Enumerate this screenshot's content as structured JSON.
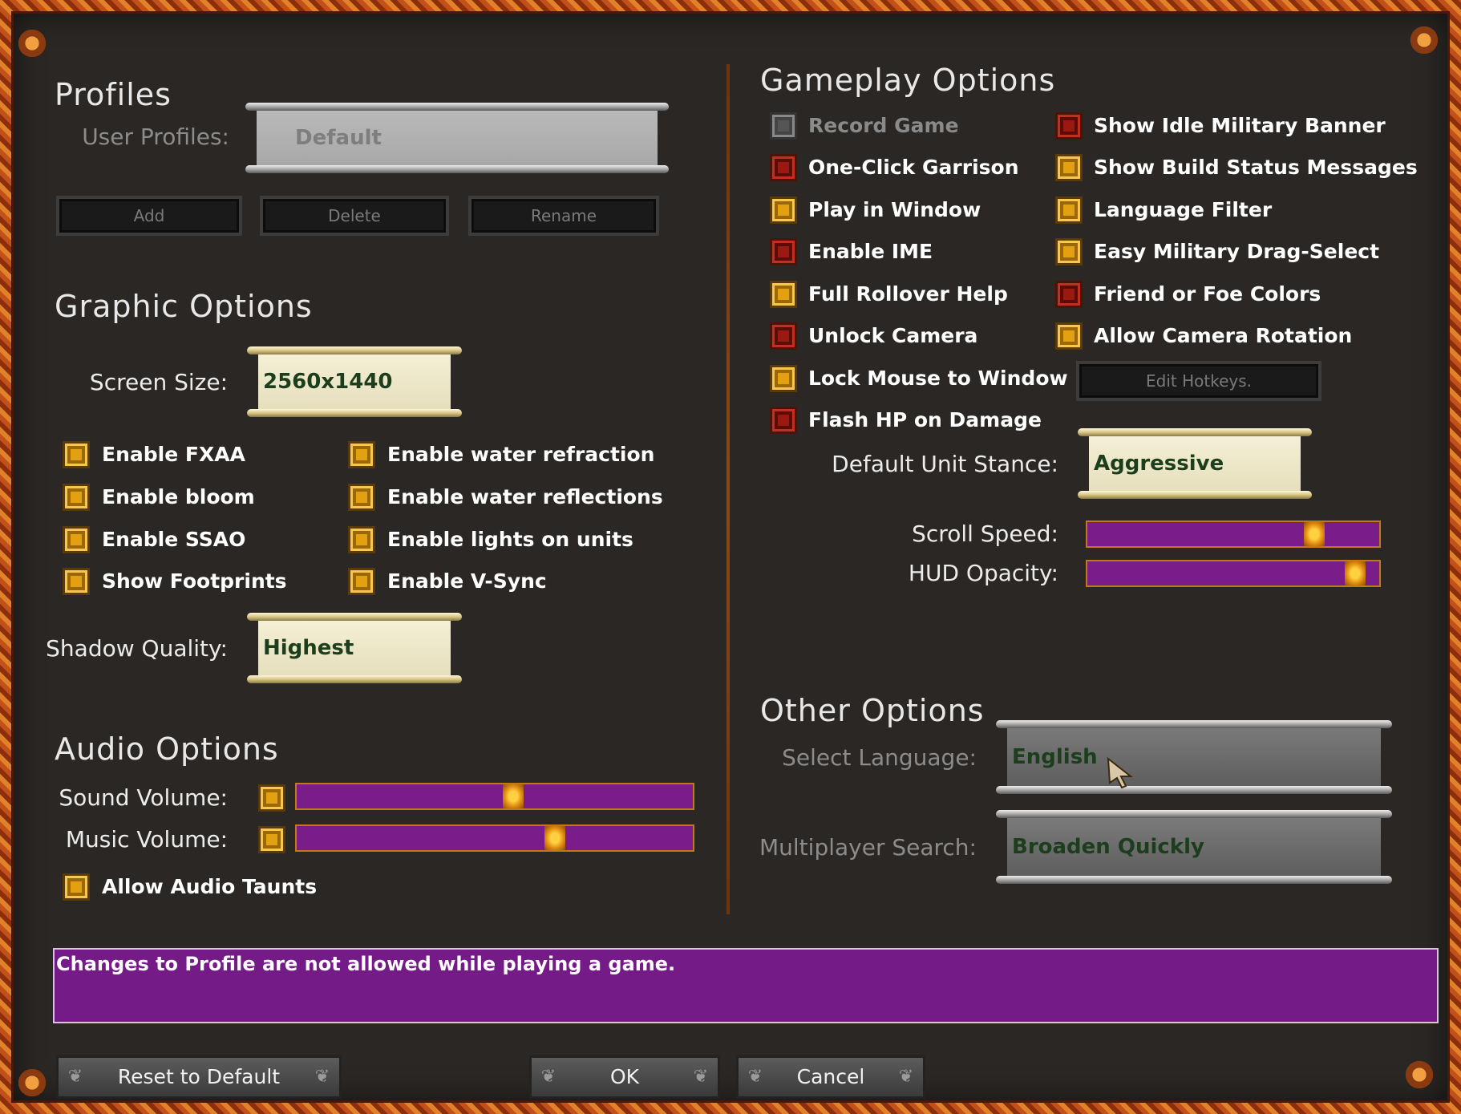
{
  "colors": {
    "frame": "#c2501a",
    "panel": "#2a2724",
    "slider_track": "#7a1c8a",
    "slider_border": "#c07a18",
    "checkbox_on": "#e3a010",
    "checkbox_off": "#9a1a12",
    "message_box": "#741b88",
    "dropdown_text": "#1c3e1c"
  },
  "profiles": {
    "title": "Profiles",
    "user_profiles_label": "User Profiles:",
    "user_profiles_value": "Default",
    "buttons": {
      "add": "Add",
      "delete": "Delete",
      "rename": "Rename"
    }
  },
  "graphic": {
    "title": "Graphic Options",
    "screen_size_label": "Screen Size:",
    "screen_size_value": "2560x1440",
    "checks": [
      {
        "label": "Enable FXAA",
        "checked": true
      },
      {
        "label": "Enable bloom",
        "checked": true
      },
      {
        "label": "Enable SSAO",
        "checked": true
      },
      {
        "label": "Show Footprints",
        "checked": true
      },
      {
        "label": "Enable water refraction",
        "checked": true
      },
      {
        "label": "Enable water reflections",
        "checked": true
      },
      {
        "label": "Enable lights on units",
        "checked": true
      },
      {
        "label": "Enable V-Sync",
        "checked": true
      }
    ],
    "shadow_quality_label": "Shadow Quality:",
    "shadow_quality_value": "Highest"
  },
  "audio": {
    "title": "Audio Options",
    "sound_volume_label": "Sound Volume:",
    "sound_volume_level": 0.55,
    "music_volume_label": "Music Volume:",
    "music_volume_level": 0.66,
    "taunts_label": "Allow Audio Taunts",
    "taunts_checked": true
  },
  "gameplay": {
    "title": "Gameplay Options",
    "left_checks": [
      {
        "label": "Record Game",
        "state": "disabled"
      },
      {
        "label": "One-Click Garrison",
        "state": "off"
      },
      {
        "label": "Play in Window",
        "state": "on"
      },
      {
        "label": "Enable IME",
        "state": "off"
      },
      {
        "label": "Full Rollover Help",
        "state": "on"
      },
      {
        "label": "Unlock Camera",
        "state": "off"
      },
      {
        "label": "Lock Mouse to Window",
        "state": "on"
      },
      {
        "label": "Flash HP on Damage",
        "state": "off"
      }
    ],
    "right_checks": [
      {
        "label": "Show Idle Military Banner",
        "state": "off"
      },
      {
        "label": "Show Build Status Messages",
        "state": "on"
      },
      {
        "label": "Language Filter",
        "state": "on"
      },
      {
        "label": "Easy Military Drag-Select",
        "state": "on"
      },
      {
        "label": "Friend or Foe Colors",
        "state": "off"
      },
      {
        "label": "Allow Camera Rotation",
        "state": "on"
      }
    ],
    "edit_hotkeys_label": "Edit Hotkeys.",
    "default_stance_label": "Default Unit Stance:",
    "default_stance_value": "Aggressive",
    "scroll_speed_label": "Scroll Speed:",
    "scroll_speed_level": 0.8,
    "hud_opacity_label": "HUD Opacity:",
    "hud_opacity_level": 0.95
  },
  "other": {
    "title": "Other Options",
    "language_label": "Select Language:",
    "language_value": "English",
    "mp_search_label": "Multiplayer Search:",
    "mp_search_value": "Broaden Quickly"
  },
  "message": "Changes to Profile are not allowed while playing a game.",
  "footer": {
    "reset_label": "Reset to Default",
    "ok_label": "OK",
    "cancel_label": "Cancel"
  }
}
